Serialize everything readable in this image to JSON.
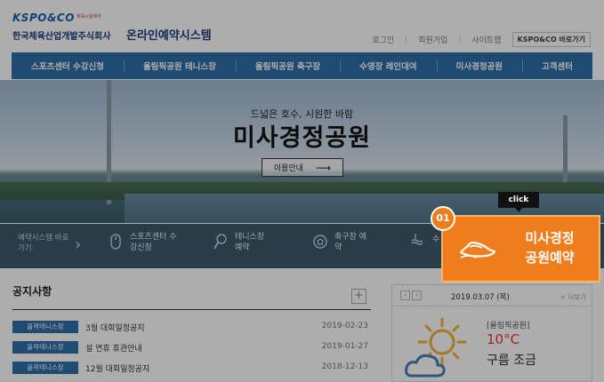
{
  "header": {
    "brand": "KSPO&CO",
    "brand_sub": "체육시설예약",
    "org_name": "한국체육산업개발주식회사",
    "system_title": "온라인예약시스템",
    "util_links": [
      "로그인",
      "회원가입",
      "사이트맵"
    ],
    "kspo_button": "KSPO&CO 바로가기"
  },
  "nav": {
    "items": [
      "스포츠센터 수강신청",
      "올림픽공원 테니스장",
      "올림픽공원 축구장",
      "수영장 레인대여",
      "미사경정공원",
      "고객센터"
    ]
  },
  "hero": {
    "tagline": "드넓은 호수, 시원한 바람",
    "title": "미사경정공원",
    "button_label": "이용안내",
    "button_arrow": "⟶"
  },
  "quick_bar": {
    "label": "예약시스템 바로가기",
    "chevron": "›",
    "items": [
      {
        "label": "스포츠센터 수강신청",
        "icon": "mouse-icon",
        "glyph": "🖱"
      },
      {
        "label": "테니스장 예약",
        "icon": "tennis-racket-icon",
        "glyph": "🎾"
      },
      {
        "label": "축구장 예약",
        "icon": "soccer-ball-icon",
        "glyph": "⚽"
      },
      {
        "label": "수",
        "icon": "swimming-icon",
        "glyph": "≋"
      }
    ]
  },
  "cta": {
    "step": "01",
    "label_line1": "미사경정",
    "label_line2": "공원예약",
    "icon": "boat-icon",
    "tooltip": "click",
    "color": "#f07d1c"
  },
  "notice": {
    "title": "공지사항",
    "more": "+",
    "rows": [
      {
        "tag": "올팍테니스장",
        "text": "3월 대회일정공지",
        "date": "2019-02-23"
      },
      {
        "tag": "올팍테니스장",
        "text": "설 연휴 휴관안내",
        "date": "2019-01-27"
      },
      {
        "tag": "올팍테니스장",
        "text": "12월 대회일정공지",
        "date": "2018-12-13"
      }
    ]
  },
  "weather": {
    "prev": "‹",
    "next": "›",
    "date": "2019.03.07 (목)",
    "more": "+ 더보기",
    "location": "[올림픽공원]",
    "temperature": "10°C",
    "condition": "구름 조금",
    "icon": "partly-cloudy-icon"
  },
  "colors": {
    "nav": "#2f6fa8",
    "accent": "#f07d1c",
    "temp": "#e33333"
  }
}
